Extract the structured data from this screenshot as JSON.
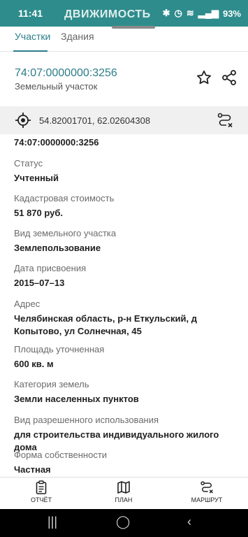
{
  "status_bar": {
    "time": "11:41",
    "app_name": "ДВИЖИМОСТЬ",
    "battery": "93%"
  },
  "tabs": [
    {
      "label": "Участки",
      "active": true
    },
    {
      "label": "Здания",
      "active": false
    }
  ],
  "header": {
    "cadastral_number": "74:07:0000000:3256",
    "object_type": "Земельный участок"
  },
  "coordinates": "54.82001701, 62.02604308",
  "details": {
    "top_value": "74:07:0000000:3256",
    "fields": [
      {
        "label": "Статус",
        "value": "Учтенный"
      },
      {
        "label": "Кадастровая стоимость",
        "value": "51 870 руб."
      },
      {
        "label": "Вид земельного участка",
        "value": "Землепользование"
      },
      {
        "label": "Дата присвоения",
        "value": "2015–07–13"
      },
      {
        "label": "Адрес",
        "value": "Челябинская область, р-н Еткульский, д Копытово, ул Солнечная, 45"
      },
      {
        "label": "Площадь уточненная",
        "value": "600 кв. м"
      },
      {
        "label": "Категория земель",
        "value": "Земли населенных пунктов"
      },
      {
        "label": "Вид разрешенного использования",
        "value": "для строительства индивидуального жилого дома"
      },
      {
        "label": "Форма собственности",
        "value": "Частная"
      }
    ]
  },
  "bottom_nav": [
    {
      "label": "ОТЧЁТ",
      "icon": "report-icon"
    },
    {
      "label": "ПЛАН",
      "icon": "map-icon"
    },
    {
      "label": "МАРШРУТ",
      "icon": "route-icon"
    }
  ],
  "colors": {
    "accent": "#2c7d8a",
    "status_bar": "#2f8c8c"
  }
}
